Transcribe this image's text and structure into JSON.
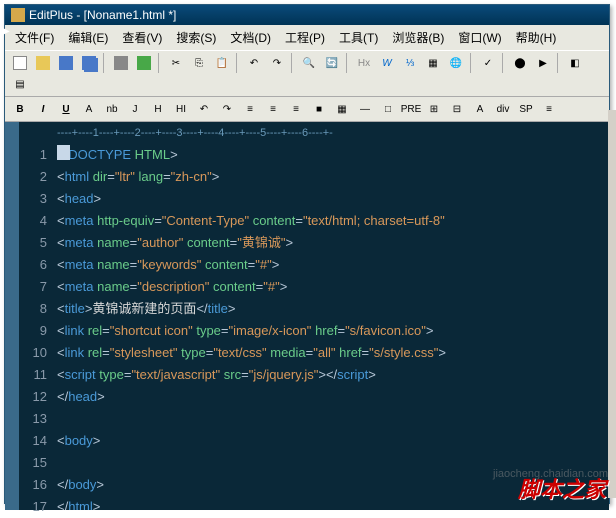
{
  "title": "EditPlus - [Noname1.html *]",
  "menu": {
    "file": "文件(F)",
    "edit": "编辑(E)",
    "view": "查看(V)",
    "search": "搜索(S)",
    "doc": "文档(D)",
    "project": "工程(P)",
    "tool": "工具(T)",
    "browser": "浏览器(B)",
    "window": "窗口(W)",
    "help": "帮助(H)"
  },
  "ruler": "----+----1----+----2----+----3----+----4----+----5----+----6----+-",
  "lines": [
    {
      "n": "1",
      "seg": [
        [
          "brk",
          "<"
        ],
        [
          "tag",
          "!DOCTYPE "
        ],
        [
          "attr",
          "HTML"
        ],
        [
          "brk",
          ">"
        ]
      ]
    },
    {
      "n": "2",
      "seg": [
        [
          "brk",
          "<"
        ],
        [
          "tag",
          "html "
        ],
        [
          "attr",
          "dir"
        ],
        [
          "brk",
          "="
        ],
        [
          "val",
          "\"ltr\""
        ],
        [
          "tag",
          " "
        ],
        [
          "attr",
          "lang"
        ],
        [
          "brk",
          "="
        ],
        [
          "val",
          "\"zh-cn\""
        ],
        [
          "brk",
          ">"
        ]
      ]
    },
    {
      "n": "3",
      "seg": [
        [
          "brk",
          "<"
        ],
        [
          "tag",
          "head"
        ],
        [
          "brk",
          ">"
        ]
      ]
    },
    {
      "n": "4",
      "seg": [
        [
          "brk",
          "<"
        ],
        [
          "tag",
          "meta "
        ],
        [
          "attr",
          "http-equiv"
        ],
        [
          "brk",
          "="
        ],
        [
          "val",
          "\"Content-Type\""
        ],
        [
          "tag",
          " "
        ],
        [
          "attr",
          "content"
        ],
        [
          "brk",
          "="
        ],
        [
          "val",
          "\"text/html; charset=utf-8\""
        ]
      ]
    },
    {
      "n": "5",
      "seg": [
        [
          "brk",
          "<"
        ],
        [
          "tag",
          "meta "
        ],
        [
          "attr",
          "name"
        ],
        [
          "brk",
          "="
        ],
        [
          "val",
          "\"author\""
        ],
        [
          "tag",
          " "
        ],
        [
          "attr",
          "content"
        ],
        [
          "brk",
          "="
        ],
        [
          "val",
          "\"黄锦诚\""
        ],
        [
          "brk",
          ">"
        ]
      ]
    },
    {
      "n": "6",
      "seg": [
        [
          "brk",
          "<"
        ],
        [
          "tag",
          "meta "
        ],
        [
          "attr",
          "name"
        ],
        [
          "brk",
          "="
        ],
        [
          "val",
          "\"keywords\""
        ],
        [
          "tag",
          " "
        ],
        [
          "attr",
          "content"
        ],
        [
          "brk",
          "="
        ],
        [
          "val",
          "\"#\""
        ],
        [
          "brk",
          ">"
        ]
      ]
    },
    {
      "n": "7",
      "seg": [
        [
          "brk",
          "<"
        ],
        [
          "tag",
          "meta "
        ],
        [
          "attr",
          "name"
        ],
        [
          "brk",
          "="
        ],
        [
          "val",
          "\"description\""
        ],
        [
          "tag",
          " "
        ],
        [
          "attr",
          "content"
        ],
        [
          "brk",
          "="
        ],
        [
          "val",
          "\"#\""
        ],
        [
          "brk",
          ">"
        ]
      ]
    },
    {
      "n": "8",
      "seg": [
        [
          "brk",
          "<"
        ],
        [
          "tag",
          "title"
        ],
        [
          "brk",
          ">"
        ],
        [
          "txt",
          "黄锦诚新建的页面"
        ],
        [
          "brk",
          "</"
        ],
        [
          "tag",
          "title"
        ],
        [
          "brk",
          ">"
        ]
      ]
    },
    {
      "n": "9",
      "seg": [
        [
          "brk",
          "<"
        ],
        [
          "tag",
          "link "
        ],
        [
          "attr",
          "rel"
        ],
        [
          "brk",
          "="
        ],
        [
          "val",
          "\"shortcut icon\""
        ],
        [
          "tag",
          " "
        ],
        [
          "attr",
          "type"
        ],
        [
          "brk",
          "="
        ],
        [
          "val",
          "\"image/x-icon\""
        ],
        [
          "tag",
          " "
        ],
        [
          "attr",
          "href"
        ],
        [
          "brk",
          "="
        ],
        [
          "val",
          "\"s/favicon.ico\""
        ],
        [
          "brk",
          ">"
        ]
      ]
    },
    {
      "n": "10",
      "seg": [
        [
          "brk",
          "<"
        ],
        [
          "tag",
          "link "
        ],
        [
          "attr",
          "rel"
        ],
        [
          "brk",
          "="
        ],
        [
          "val",
          "\"stylesheet\""
        ],
        [
          "tag",
          " "
        ],
        [
          "attr",
          "type"
        ],
        [
          "brk",
          "="
        ],
        [
          "val",
          "\"text/css\""
        ],
        [
          "tag",
          " "
        ],
        [
          "attr",
          "media"
        ],
        [
          "brk",
          "="
        ],
        [
          "val",
          "\"all\""
        ],
        [
          "tag",
          " "
        ],
        [
          "attr",
          "href"
        ],
        [
          "brk",
          "="
        ],
        [
          "val",
          "\"s/style.css\""
        ],
        [
          "brk",
          ">"
        ]
      ]
    },
    {
      "n": "11",
      "seg": [
        [
          "brk",
          "<"
        ],
        [
          "tag",
          "script "
        ],
        [
          "attr",
          "type"
        ],
        [
          "brk",
          "="
        ],
        [
          "val",
          "\"text/javascript\""
        ],
        [
          "tag",
          " "
        ],
        [
          "attr",
          "src"
        ],
        [
          "brk",
          "="
        ],
        [
          "val",
          "\"js/jquery.js\""
        ],
        [
          "brk",
          "></"
        ],
        [
          "tag",
          "script"
        ],
        [
          "brk",
          ">"
        ]
      ]
    },
    {
      "n": "12",
      "seg": [
        [
          "brk",
          "</"
        ],
        [
          "tag",
          "head"
        ],
        [
          "brk",
          ">"
        ]
      ]
    },
    {
      "n": "13",
      "seg": []
    },
    {
      "n": "14",
      "seg": [
        [
          "brk",
          "<"
        ],
        [
          "tag",
          "body"
        ],
        [
          "brk",
          ">"
        ]
      ]
    },
    {
      "n": "15",
      "seg": []
    },
    {
      "n": "16",
      "seg": [
        [
          "brk",
          "</"
        ],
        [
          "tag",
          "body"
        ],
        [
          "brk",
          ">"
        ]
      ]
    },
    {
      "n": "17",
      "seg": [
        [
          "brk",
          "</"
        ],
        [
          "tag",
          "html"
        ],
        [
          "brk",
          ">"
        ]
      ]
    }
  ],
  "tb2": [
    "B",
    "I",
    "U",
    "A",
    "nb",
    "J",
    "H",
    "HI",
    "↶",
    "↷",
    "≡",
    "≡",
    "≡",
    "■",
    "▦",
    "—",
    "□",
    "PRE",
    "⊞",
    "⊟",
    "A",
    "div",
    "SP",
    "≡"
  ],
  "stamp": "脚本之家",
  "watermark": "jiaocheng.chaidian.com"
}
